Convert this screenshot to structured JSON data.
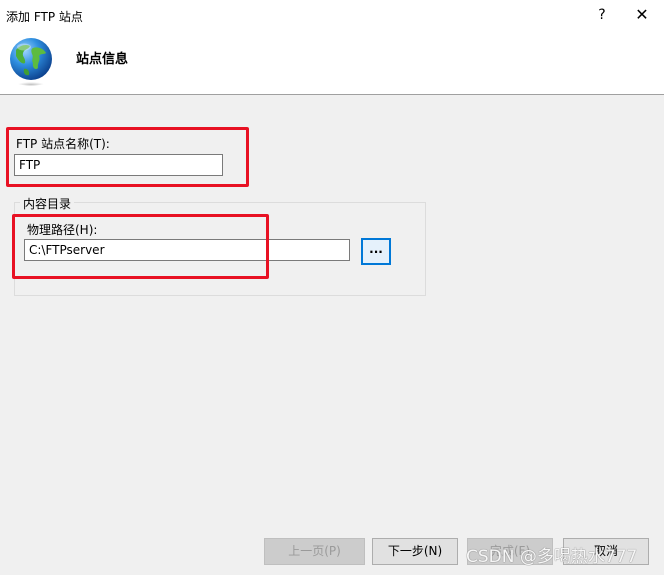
{
  "window": {
    "title": "添加 FTP 站点",
    "help_glyph": "?",
    "close_glyph": "✕"
  },
  "header": {
    "title": "站点信息",
    "icon": "globe-icon"
  },
  "site_name": {
    "label": "FTP 站点名称(T):",
    "value": "FTP"
  },
  "content_directory": {
    "legend": "内容目录",
    "path_label": "物理路径(H):",
    "path_value": "C:\\FTPserver",
    "browse_label": "..."
  },
  "buttons": {
    "previous": "上一页(P)",
    "next": "下一步(N)",
    "finish": "完成(F)",
    "cancel": "取消"
  },
  "watermark": "CSDN @多喝热水777",
  "colors": {
    "annotation": "#e81123",
    "accent": "#0078d7",
    "background": "#f0f0f0"
  }
}
